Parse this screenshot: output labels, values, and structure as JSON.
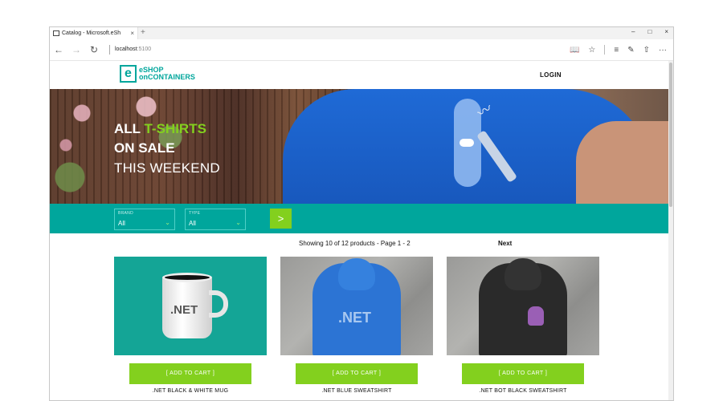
{
  "browser": {
    "tab_title": "Catalog - Microsoft.eSh",
    "tab_close": "×",
    "new_tab": "+",
    "window_controls": [
      "–",
      "□",
      "×"
    ],
    "url_host": "localhost",
    "url_port": ":5100",
    "nav": {
      "back": "←",
      "forward": "→",
      "refresh": "↻"
    },
    "tools": {
      "reading_view": "📖",
      "favorite": "☆",
      "hub": "≡",
      "note": "✎",
      "share": "⇧",
      "more": "···"
    }
  },
  "site": {
    "logo_mark": "e",
    "logo_line1": "eSHOP",
    "logo_line2": "onCONTAINERS",
    "login": "LOGIN"
  },
  "hero": {
    "line1_part1": "ALL ",
    "line1_accent": "T-SHIRTS",
    "line2": "ON SALE",
    "line3": "THIS WEEKEND"
  },
  "filters": {
    "brand_label": "BRAND",
    "brand_value": "All",
    "type_label": "TYPE",
    "type_value": "All",
    "apply_icon": ">"
  },
  "pager": {
    "summary": "Showing 10 of 12 products - Page 1 - 2",
    "next": "Next"
  },
  "products": [
    {
      "name": ".NET BLACK & WHITE MUG",
      "cart_label": "[ ADD TO CART ]",
      "image_text": ".NET"
    },
    {
      "name": ".NET BLUE SWEATSHIRT",
      "cart_label": "[ ADD TO CART ]",
      "image_text": ".NET"
    },
    {
      "name": ".NET BOT BLACK SWEATSHIRT",
      "cart_label": "[ ADD TO CART ]",
      "image_text": ""
    }
  ],
  "colors": {
    "brand_teal": "#00a69c",
    "accent_green": "#83d01e"
  }
}
